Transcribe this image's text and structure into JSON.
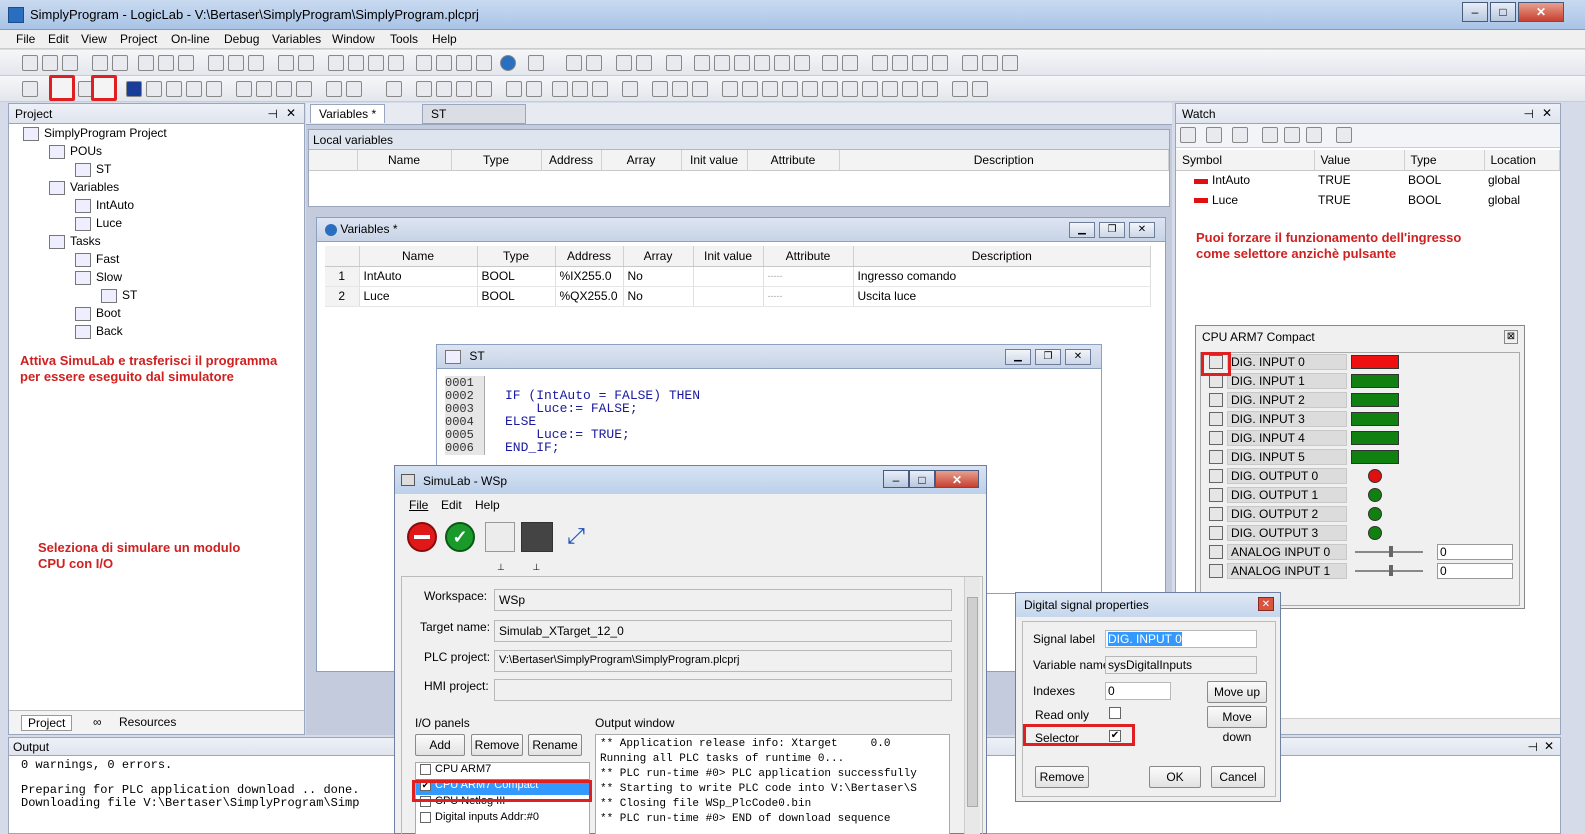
{
  "app": {
    "title": "SimplyProgram - LogicLab - V:\\Bertaser\\SimplyProgram\\SimplyProgram.plcprj"
  },
  "menu": [
    "File",
    "Edit",
    "View",
    "Project",
    "On-line",
    "Debug",
    "Variables",
    "Window",
    "Tools",
    "Help"
  ],
  "project_panel": {
    "title": "Project",
    "tree": [
      {
        "label": "SimplyProgram Project",
        "icon": "project-icon",
        "depth": 0
      },
      {
        "label": "POUs",
        "icon": "folder-icon",
        "depth": 1
      },
      {
        "label": "ST",
        "icon": "st-program-icon",
        "depth": 2
      },
      {
        "label": "Variables",
        "icon": "variables-icon",
        "depth": 1
      },
      {
        "label": "IntAuto",
        "icon": "variable-icon",
        "depth": 2
      },
      {
        "label": "Luce",
        "icon": "variable-icon",
        "depth": 2
      },
      {
        "label": "Tasks",
        "icon": "tasks-icon",
        "depth": 1
      },
      {
        "label": "Fast",
        "icon": "task-icon",
        "depth": 2
      },
      {
        "label": "Slow",
        "icon": "task-icon",
        "depth": 2
      },
      {
        "label": "ST",
        "icon": "program-icon",
        "depth": 3
      },
      {
        "label": "Boot",
        "icon": "task-icon",
        "depth": 2
      },
      {
        "label": "Back",
        "icon": "task-icon",
        "depth": 2
      }
    ],
    "tabs": [
      "Project",
      "Resources"
    ]
  },
  "notes": {
    "simulab": "Attiva SimuLab e trasferisci il programma\nper essere eseguito dal simulatore",
    "cpu": "Seleziona di simulare un modulo\nCPU con I/O",
    "selector": "Puoi forzare il funzionamento dell'ingresso\ncome selettore anzichè pulsante"
  },
  "editor_tabs": [
    "Variables *",
    "ST"
  ],
  "local_vars": {
    "title": "Local variables",
    "columns": [
      "Name",
      "Type",
      "Address",
      "Array",
      "Init value",
      "Attribute",
      "Description"
    ]
  },
  "variables_window": {
    "title": "Variables *",
    "columns": [
      "Name",
      "Type",
      "Address",
      "Array",
      "Init value",
      "Attribute",
      "Description"
    ],
    "rows": [
      [
        "1",
        "IntAuto",
        "BOOL",
        "%IX255.0",
        "No",
        "",
        "-----",
        "Ingresso comando"
      ],
      [
        "2",
        "Luce",
        "BOOL",
        "%QX255.0",
        "No",
        "",
        "-----",
        "Uscita luce"
      ]
    ]
  },
  "st_window": {
    "title": "ST",
    "lines": [
      {
        "n": "0001",
        "text": ""
      },
      {
        "n": "0002",
        "text": "IF (IntAuto = FALSE) THEN"
      },
      {
        "n": "0003",
        "text": "    Luce:= FALSE;"
      },
      {
        "n": "0004",
        "text": "ELSE"
      },
      {
        "n": "0005",
        "text": "    Luce:= TRUE;"
      },
      {
        "n": "0006",
        "text": "END_IF;"
      }
    ]
  },
  "watch": {
    "title": "Watch",
    "columns": [
      "Symbol",
      "Value",
      "Type",
      "Location"
    ],
    "rows": [
      [
        "IntAuto",
        "TRUE",
        "BOOL",
        "global"
      ],
      [
        "Luce",
        "TRUE",
        "BOOL",
        "global"
      ]
    ]
  },
  "cpu_panel": {
    "title": "CPU ARM7 Compact",
    "close": "⊠",
    "io": [
      {
        "label": "DIG. INPUT 0",
        "kind": "bar",
        "color": "#ee1010"
      },
      {
        "label": "DIG. INPUT 1",
        "kind": "bar",
        "color": "#108010"
      },
      {
        "label": "DIG. INPUT 2",
        "kind": "bar",
        "color": "#108010"
      },
      {
        "label": "DIG. INPUT 3",
        "kind": "bar",
        "color": "#108010"
      },
      {
        "label": "DIG. INPUT 4",
        "kind": "bar",
        "color": "#108010"
      },
      {
        "label": "DIG. INPUT 5",
        "kind": "bar",
        "color": "#108010"
      },
      {
        "label": "DIG. OUTPUT 0",
        "kind": "led",
        "color": "#e01010"
      },
      {
        "label": "DIG. OUTPUT 1",
        "kind": "led",
        "color": "#108010"
      },
      {
        "label": "DIG. OUTPUT 2",
        "kind": "led",
        "color": "#108010"
      },
      {
        "label": "DIG. OUTPUT 3",
        "kind": "led",
        "color": "#108010"
      },
      {
        "label": "ANALOG INPUT 0",
        "kind": "slider",
        "value": "0"
      },
      {
        "label": "ANALOG INPUT 1",
        "kind": "slider",
        "value": "0"
      }
    ]
  },
  "simulab": {
    "title": "SimuLab - WSp",
    "menu": [
      "File",
      "Edit",
      "Help"
    ],
    "fields": [
      {
        "label": "Workspace:",
        "value": "WSp"
      },
      {
        "label": "Target name:",
        "value": "Simulab_XTarget_12_0"
      },
      {
        "label": "PLC project:",
        "value": "V:\\Bertaser\\SimplyProgram\\SimplyProgram.plcprj"
      },
      {
        "label": "HMI project:",
        "value": ""
      }
    ],
    "io_panels_label": "I/O panels",
    "buttons": [
      "Add",
      "Remove",
      "Rename"
    ],
    "panels": [
      {
        "label": "CPU ARM7",
        "checked": false
      },
      {
        "label": "CPU ARM7 Compact",
        "checked": true
      },
      {
        "label": "CPU Netlog III",
        "checked": false
      },
      {
        "label": "Digital inputs Addr:#0",
        "checked": false
      }
    ],
    "output_label": "Output window",
    "output": [
      "** Application release info: Xtarget     0.0",
      "Running all PLC tasks of runtime 0...",
      "** PLC run-time #0> PLC application successfully",
      "** Starting to write PLC code into V:\\Bertaser\\S",
      "** Closing file WSp_PlcCode0.bin",
      "** PLC run-time #0> END of download sequence"
    ]
  },
  "dsp": {
    "title": "Digital signal properties",
    "signal_label": "Signal label",
    "signal_value": "DIG. INPUT 0",
    "varname_label": "Variable name",
    "varname_value": "sysDigitalInputs",
    "indexes_label": "Indexes",
    "indexes_value": "0",
    "readonly_label": "Read only",
    "selector_label": "Selector",
    "selector_check": "✔",
    "buttons": {
      "move_up": "Move up",
      "move_down": "Move down",
      "remove": "Remove",
      "ok": "OK",
      "cancel": "Cancel"
    }
  },
  "output_panel": {
    "title": "Output",
    "lines": [
      "0 warnings, 0 errors.",
      "",
      "Preparing for PLC application download .. done.",
      "Downloading file V:\\Bertaser\\SimplyProgram\\Simp"
    ]
  }
}
